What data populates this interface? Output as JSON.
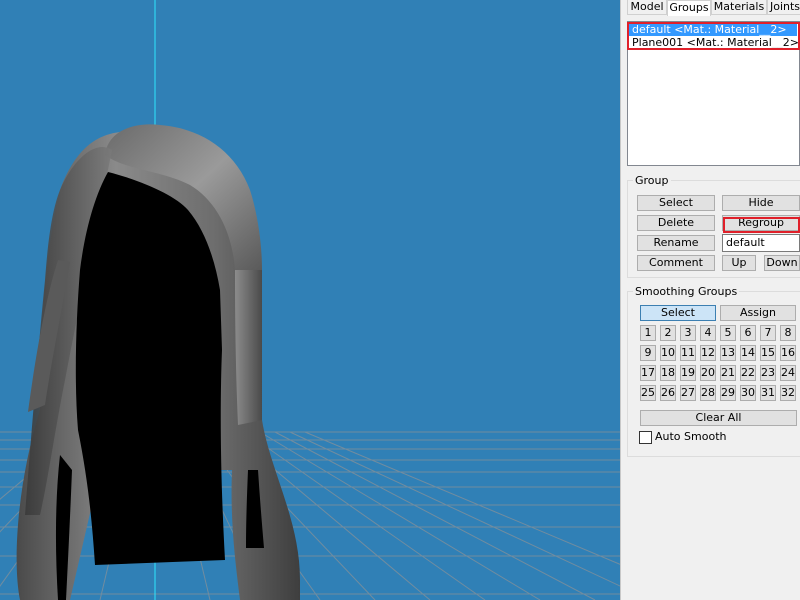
{
  "tabs": [
    "Model",
    "Groups",
    "Materials",
    "Joints"
  ],
  "active_tab": "Groups",
  "groups_list": [
    {
      "label": "default <Mat.: Material__2>",
      "selected": true
    },
    {
      "label": "Plane001 <Mat.: Material__2>",
      "selected": false
    }
  ],
  "group_section": {
    "title": "Group",
    "select_label": "Select",
    "hide_label": "Hide",
    "delete_label": "Delete",
    "regroup_label": "Regroup",
    "rename_label": "Rename",
    "name_value": "default",
    "comment_label": "Comment",
    "up_label": "Up",
    "down_label": "Down"
  },
  "smoothing_section": {
    "title": "Smoothing Groups",
    "select_label": "Select",
    "assign_label": "Assign",
    "numbers": [
      "1",
      "2",
      "3",
      "4",
      "5",
      "6",
      "7",
      "8",
      "9",
      "10",
      "11",
      "12",
      "13",
      "14",
      "15",
      "16",
      "17",
      "18",
      "19",
      "20",
      "21",
      "22",
      "23",
      "24",
      "25",
      "26",
      "27",
      "28",
      "29",
      "30",
      "31",
      "32"
    ],
    "clear_all_label": "Clear All",
    "auto_smooth_label": "Auto Smooth",
    "auto_smooth_checked": false
  },
  "colors": {
    "viewport_bg": "#3080b6",
    "selection": "#3399ff",
    "highlight_frame": "#e0202a"
  }
}
